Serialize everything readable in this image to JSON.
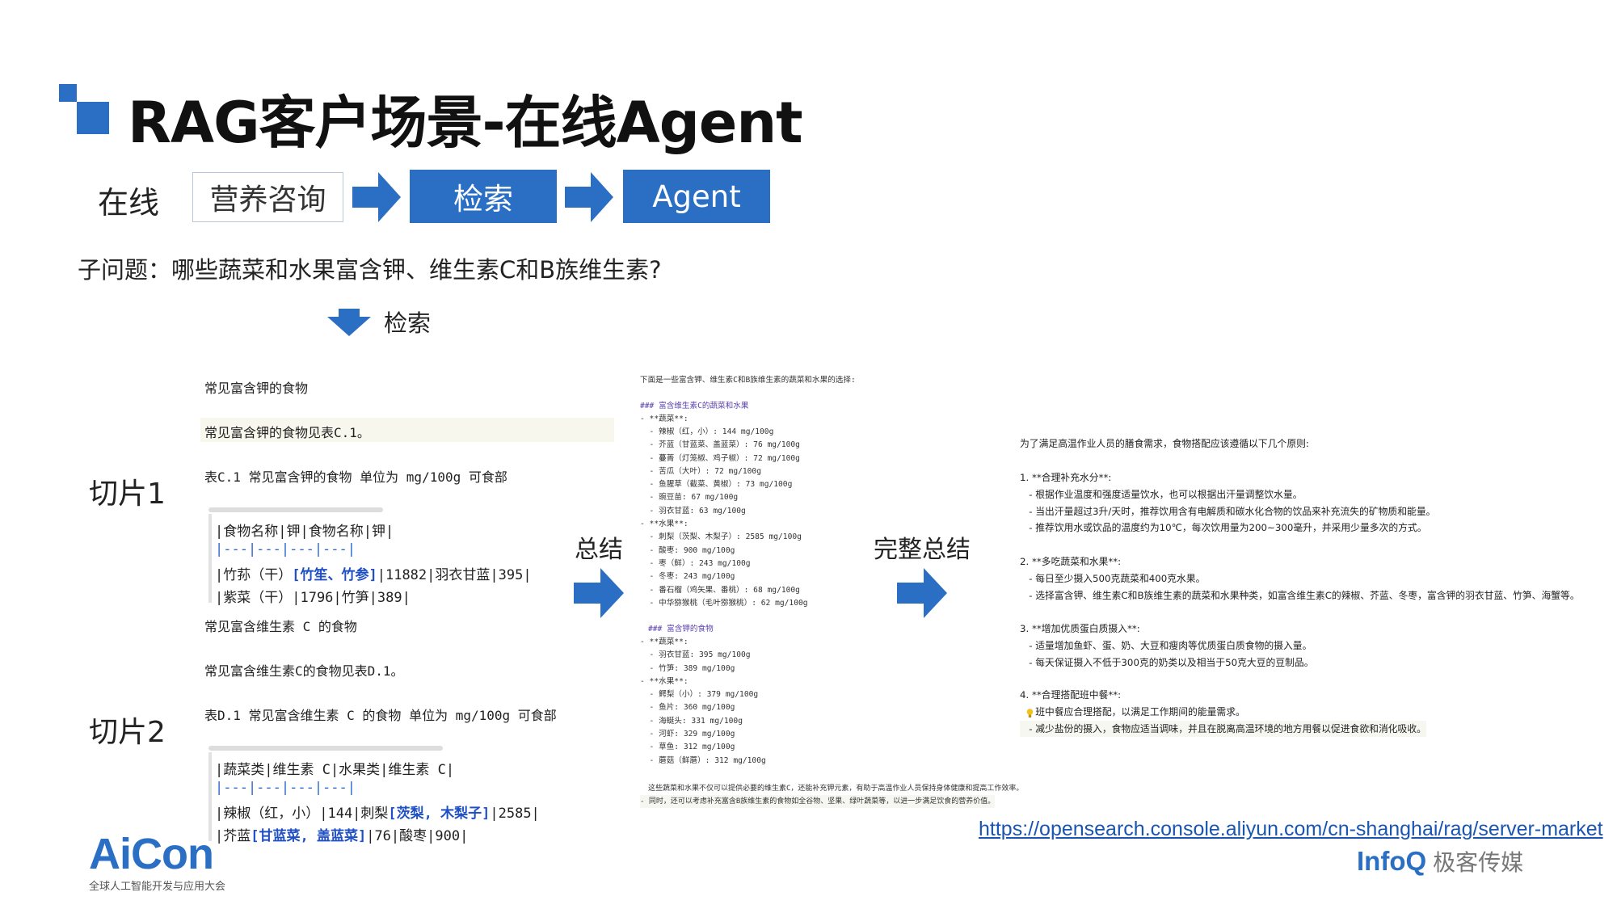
{
  "title": "RAG客户场景-在线Agent",
  "flow": {
    "label": "在线",
    "step1": "营养咨询",
    "step2": "检索",
    "step3": "Agent"
  },
  "subquestion": "子问题：哪些蔬菜和水果富含钾、维生素C和B族维生素?",
  "retrieve_label": "检索",
  "chunk1": {
    "label": "切片1",
    "line1": "常见富含钾的食物",
    "line2": "常见富含钾的食物见表C.1。",
    "line3": "表C.1 常见富含钾的食物 单位为 mg/100g 可食部",
    "t_header": "|食物名称|钾|食物名称|钾|",
    "t_sep": "|---|---|---|---|",
    "t_r1_a": "|竹荪（干）",
    "t_r1_b": "[竹笙、竹参]",
    "t_r1_c": "|11882|羽衣甘蓝|395|",
    "t_r2": "|紫菜（干）|1796|竹笋|389|"
  },
  "chunk2": {
    "label": "切片2",
    "line1": "常见富含维生素 C 的食物",
    "line2": "常见富含维生素C的食物见表D.1。",
    "line3": "表D.1 常见富含维生素 C 的食物 单位为 mg/100g 可食部",
    "t_header": "|蔬菜类|维生素 C|水果类|维生素 C|",
    "t_sep": "|---|---|---|---|",
    "t_r1_a": "|辣椒（红，小）|144|刺梨",
    "t_r1_b": "[茨梨, 木梨子]",
    "t_r1_c": "|2585|",
    "t_r2_a": "|芥蓝",
    "t_r2_b": "[甘蓝菜, 盖蓝菜]",
    "t_r2_c": "|76|酸枣|900|"
  },
  "summary_label": "总结",
  "full_summary_label": "完整总结",
  "summary": {
    "intro": "下面是一些富含钾、维生素C和B族维生素的蔬菜和水果的选择:",
    "h1": "### 富含维生素C的蔬菜和水果",
    "s1": "- **蔬菜**:",
    "s1_items": [
      "  - 辣椒（红，小）: 144 mg/100g",
      "  - 芥蓝（甘蓝菜、盖蓝菜）: 76 mg/100g",
      "  - 蔓菁（灯笼椒、鸡子椒）: 72 mg/100g",
      "  - 苦瓜（大叶）: 72 mg/100g",
      "  - 鱼腥草（截菜、黄椒）: 73 mg/100g",
      "  - 豌豆苗: 67 mg/100g",
      "  - 羽衣甘蓝: 63 mg/100g"
    ],
    "s2": "- **水果**:",
    "s2_items": [
      "  - 刺梨（茨梨、木梨子）: 2585 mg/100g",
      "  - 酸枣: 900 mg/100g",
      "  - 枣（鲜）: 243 mg/100g",
      "  - 冬枣: 243 mg/100g",
      "  - 番石榴（鸡矢果、番桃）: 68 mg/100g",
      "  - 中华猕猴桃（毛叶猕猴桃）: 62 mg/100g"
    ],
    "h2": "### 富含钾的食物",
    "s3": "- **蔬菜**:",
    "s3_items": [
      "  - 羽衣甘蓝: 395 mg/100g",
      "  - 竹笋: 389 mg/100g"
    ],
    "s4": "- **水果**:",
    "s4_items": [
      "  - 鳄梨（小）: 379 mg/100g",
      "  - 鱼片: 360 mg/100g",
      "  - 海蜒头: 331 mg/100g",
      "  - 河虾: 329 mg/100g",
      "  - 草鱼: 312 mg/100g",
      "  - 蘑菇（鲜蘑）: 312 mg/100g"
    ],
    "footer1": "这些蔬菜和水果不仅可以提供必要的维生素C，还能补充钾元素，有助于高温作业人员保持身体健康和提高工作效率。",
    "footer2": "- 同时，还可以考虑补充富含B族维生素的食物如全谷物、坚果、绿叶蔬菜等，以进一步满足饮食的营养价值。"
  },
  "full": {
    "intro": "为了满足高温作业人员的膳食需求，食物搭配应该遵循以下几个原则:",
    "p1_title": "1. **合理补充水分**:",
    "p1_items": [
      "   - 根据作业温度和强度适量饮水，也可以根据出汗量调整饮水量。",
      "   - 当出汗量超过3升/天时，推荐饮用含有电解质和碳水化合物的饮品来补充流失的矿物质和能量。",
      "   - 推荐饮用水或饮品的温度约为10℃，每次饮用量为200~300毫升，并采用少量多次的方式。"
    ],
    "p2_title": "2. **多吃蔬菜和水果**:",
    "p2_items": [
      "   - 每日至少摄入500克蔬菜和400克水果。",
      "   - 选择富含钾、维生素C和B族维生素的蔬菜和水果种类，如富含维生素C的辣椒、芥蓝、冬枣，富含钾的羽衣甘蓝、竹笋、海蟹等。"
    ],
    "p3_title": "3. **增加优质蛋白质摄入**:",
    "p3_items": [
      "   - 适量增加鱼虾、蛋、奶、大豆和瘦肉等优质蛋白质食物的摄入量。",
      "   - 每天保证摄入不低于300克的奶类以及相当于50克大豆的豆制品。"
    ],
    "p4_title": "4. **合理搭配班中餐**:",
    "p4_items": [
      "   - 班中餐应合理搭配，以满足工作期间的能量需求。",
      "   - 减少盐份的摄入，食物应适当调味，并且在脱离高温环境的地方用餐以促进食欲和消化吸收。"
    ]
  },
  "url": "https://opensearch.console.aliyun.com/cn-shanghai/rag/server-market",
  "aicon": {
    "name": "AiCon",
    "subtitle": "全球人工智能开发与应用大会"
  },
  "infoq": {
    "name": "InfoQ",
    "cn": "极客传媒"
  },
  "colors": {
    "accent": "#2a6fc4",
    "link": "#1a56b0"
  }
}
